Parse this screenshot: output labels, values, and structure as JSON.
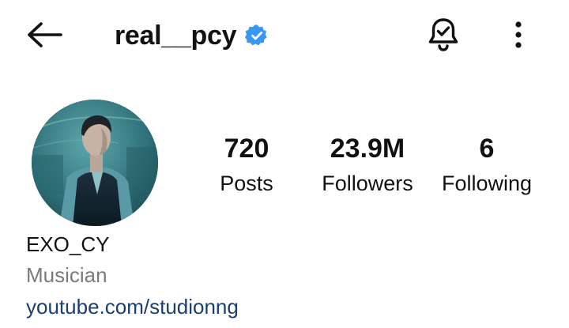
{
  "header": {
    "username": "real__pcy",
    "verified": true,
    "back_icon": "arrow-left-icon",
    "notification_icon": "bell-check-icon",
    "more_icon": "vertical-dots-icon"
  },
  "profile": {
    "avatar": "profile-photo",
    "stats": [
      {
        "value": "720",
        "label": "Posts"
      },
      {
        "value": "23.9M",
        "label": "Followers"
      },
      {
        "value": "6",
        "label": "Following"
      }
    ],
    "display_name": "EXO_CY",
    "category": "Musician",
    "link": "youtube.com/studionng"
  },
  "colors": {
    "verified_badge": "#3897f0",
    "link": "#1b3f6e",
    "category": "#7a7a7a"
  }
}
